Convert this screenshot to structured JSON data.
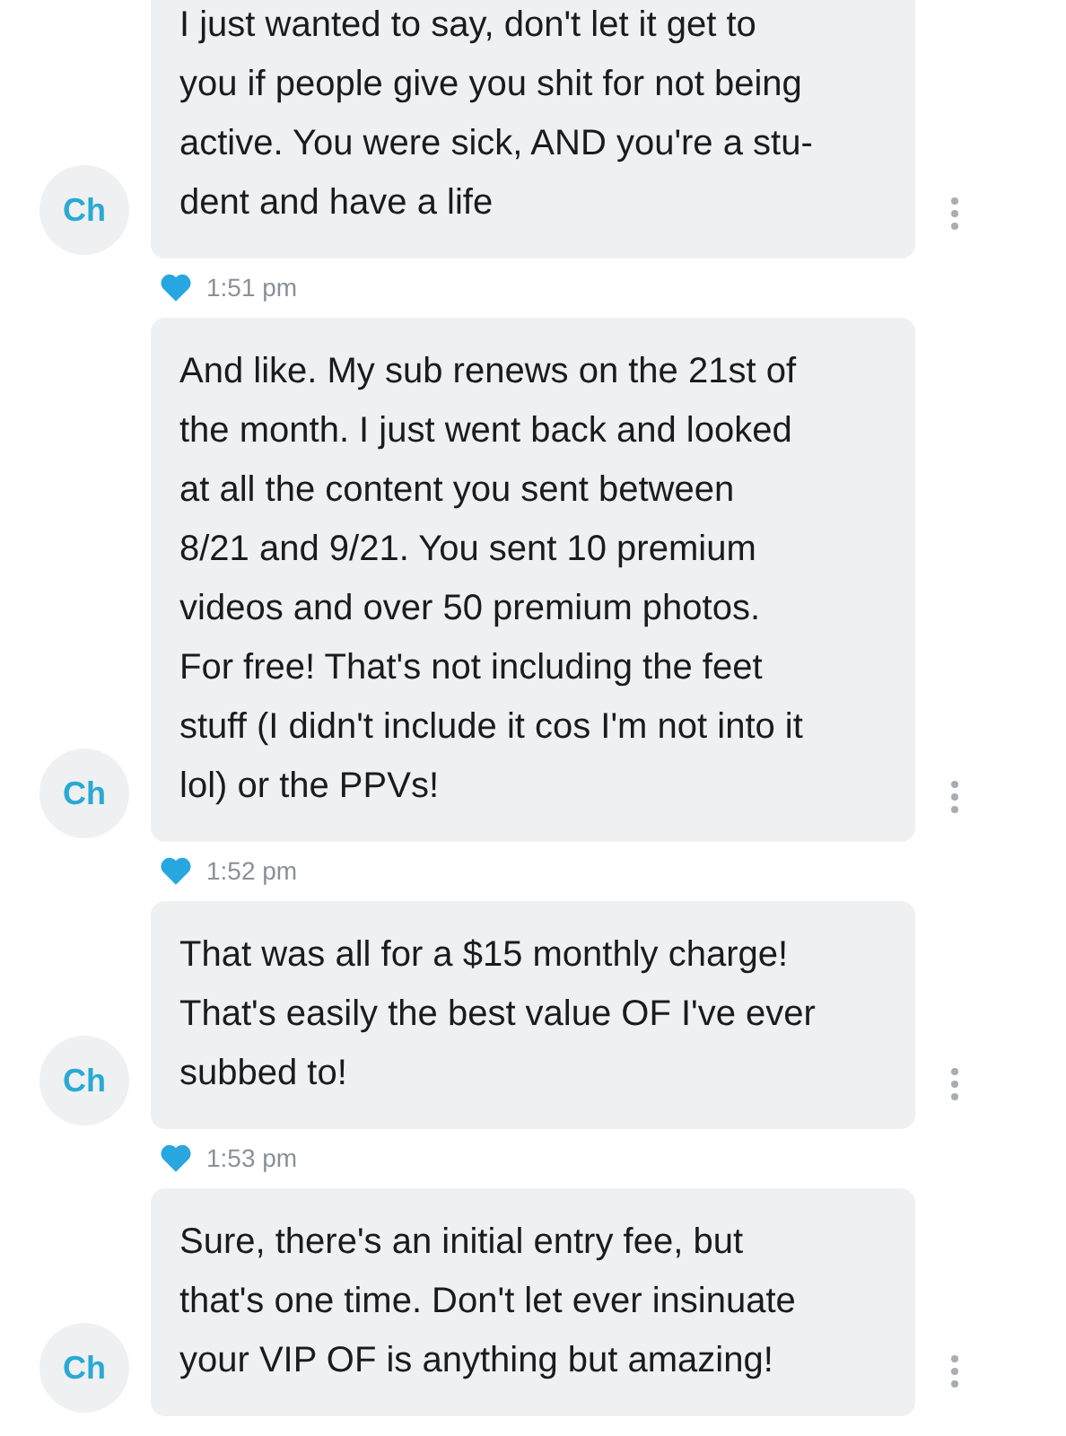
{
  "messages": [
    {
      "avatar": "Ch",
      "lines": [
        "I just wanted to say, don't let it get to",
        "you if people give you shit for not being",
        "active. You were sick, AND you're a stu-",
        "dent and have a life"
      ],
      "liked": true,
      "time": "1:51 pm"
    },
    {
      "avatar": "Ch",
      "lines": [
        "And like. My sub renews on the 21st of",
        "the month. I just went back and looked",
        "at all the content you sent between",
        "8/21 and 9/21. You sent 10 premium",
        "videos and over 50 premium photos.",
        "For free! That's not including the feet",
        "stuff (I didn't include it cos I'm not into it",
        "lol) or the PPVs!"
      ],
      "liked": true,
      "time": "1:52 pm"
    },
    {
      "avatar": "Ch",
      "lines": [
        "That was all for a $15 monthly charge!",
        "That's easily the best value OF I've ever",
        "subbed to!"
      ],
      "liked": true,
      "time": "1:53 pm"
    },
    {
      "avatar": "Ch",
      "lines": [
        "Sure, there's an initial entry fee, but",
        "that's one time. Don't let ever insinuate",
        "your VIP OF is anything but amazing!"
      ]
    }
  ]
}
